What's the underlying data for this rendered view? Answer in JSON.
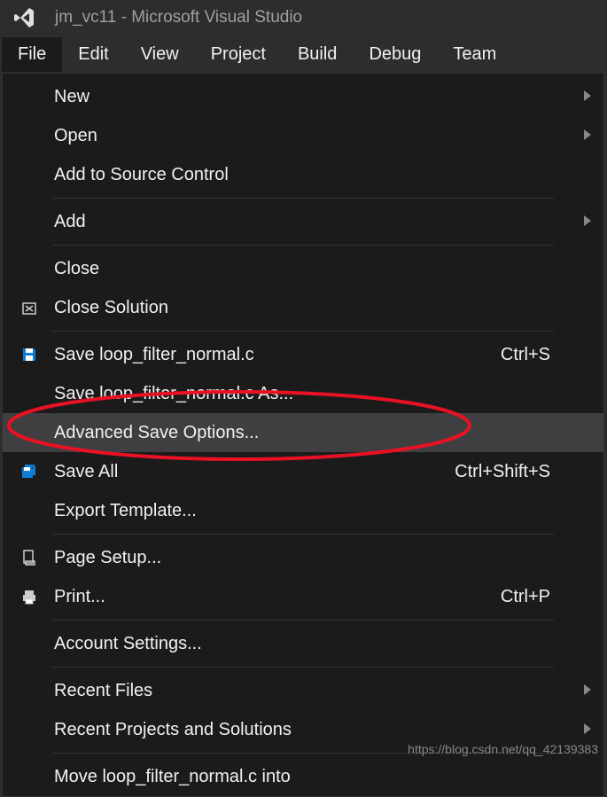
{
  "titlebar": {
    "title": "jm_vc11 - Microsoft Visual Studio"
  },
  "menubar": {
    "items": [
      {
        "label": "File",
        "active": true
      },
      {
        "label": "Edit"
      },
      {
        "label": "View"
      },
      {
        "label": "Project"
      },
      {
        "label": "Build"
      },
      {
        "label": "Debug"
      },
      {
        "label": "Team"
      }
    ]
  },
  "dropdown": {
    "items": [
      {
        "type": "item",
        "label": "New",
        "submenu": true
      },
      {
        "type": "item",
        "label": "Open",
        "submenu": true
      },
      {
        "type": "item",
        "label": "Add to Source Control"
      },
      {
        "type": "separator"
      },
      {
        "type": "item",
        "label": "Add",
        "submenu": true
      },
      {
        "type": "separator"
      },
      {
        "type": "item",
        "label": "Close"
      },
      {
        "type": "item",
        "label": "Close Solution",
        "icon": "close-solution"
      },
      {
        "type": "separator"
      },
      {
        "type": "item",
        "label": "Save loop_filter_normal.c",
        "shortcut": "Ctrl+S",
        "icon": "save"
      },
      {
        "type": "item",
        "label": "Save loop_filter_normal.c As..."
      },
      {
        "type": "item",
        "label": "Advanced Save Options...",
        "hover": true
      },
      {
        "type": "item",
        "label": "Save All",
        "shortcut": "Ctrl+Shift+S",
        "icon": "save-all"
      },
      {
        "type": "item",
        "label": "Export Template..."
      },
      {
        "type": "separator"
      },
      {
        "type": "item",
        "label": "Page Setup...",
        "icon": "page-setup"
      },
      {
        "type": "item",
        "label": "Print...",
        "shortcut": "Ctrl+P",
        "icon": "print"
      },
      {
        "type": "separator"
      },
      {
        "type": "item",
        "label": "Account Settings..."
      },
      {
        "type": "separator"
      },
      {
        "type": "item",
        "label": "Recent Files",
        "submenu": true
      },
      {
        "type": "item",
        "label": "Recent Projects and Solutions",
        "submenu": true
      },
      {
        "type": "separator"
      },
      {
        "type": "item",
        "label": "Move loop_filter_normal.c into"
      }
    ]
  },
  "watermark": "https://blog.csdn.net/qq_42139383"
}
